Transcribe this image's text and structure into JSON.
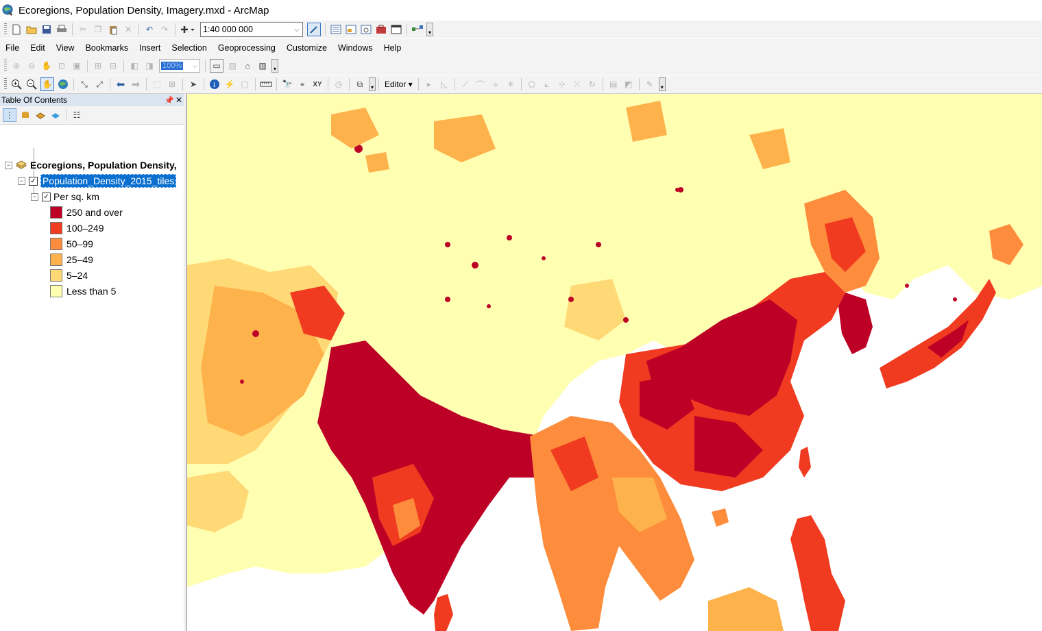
{
  "window": {
    "title": "Ecoregions, Population Density, Imagery.mxd - ArcMap"
  },
  "scale": {
    "value": "1:40 000 000"
  },
  "zoom_percent": "100%",
  "menu": [
    "File",
    "Edit",
    "View",
    "Bookmarks",
    "Insert",
    "Selection",
    "Geoprocessing",
    "Customize",
    "Windows",
    "Help"
  ],
  "editor": {
    "label": "Editor ▾"
  },
  "toc": {
    "title": "Table Of Contents",
    "data_frame": "Ecoregions, Population Density,",
    "layer": "Population_Density_2015_tiles",
    "field": "Per sq. km",
    "legend": [
      {
        "label": "250 and over",
        "color": "#bd0026"
      },
      {
        "label": "100–249",
        "color": "#f03b20"
      },
      {
        "label": "50–99",
        "color": "#fd8d3c"
      },
      {
        "label": "25–49",
        "color": "#feb24c"
      },
      {
        "label": "5–24",
        "color": "#fed976"
      },
      {
        "label": "Less than 5",
        "color": "#ffffb2"
      }
    ]
  },
  "colors": {
    "selection": "#0a6fcf",
    "toc_header": "#dbe5f1"
  }
}
